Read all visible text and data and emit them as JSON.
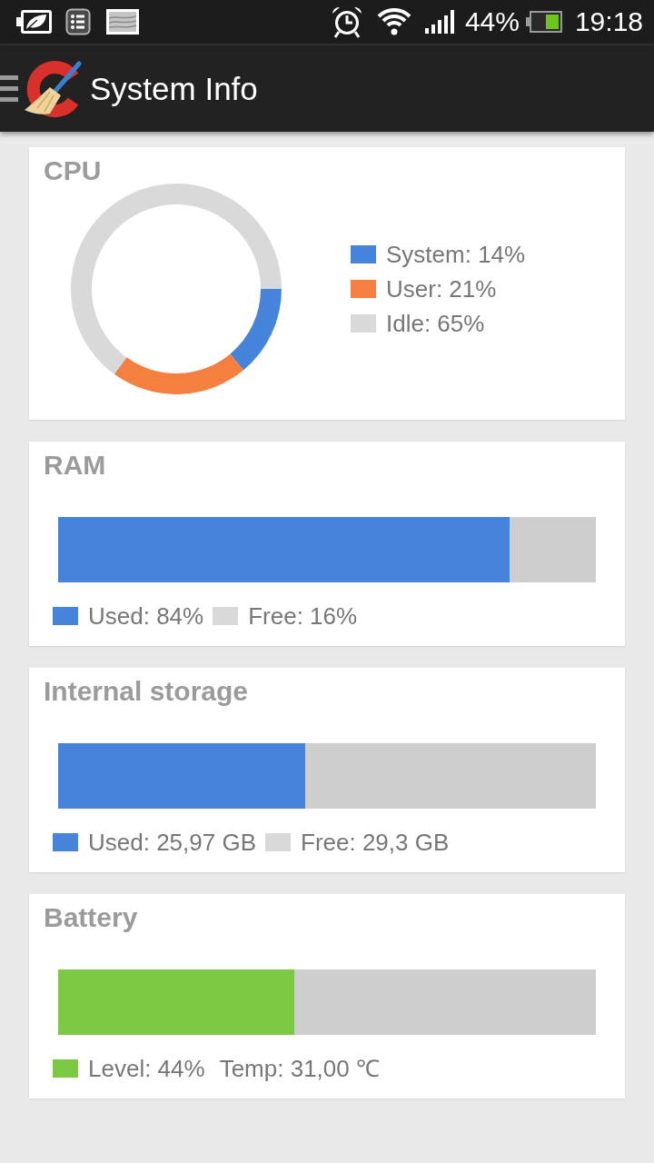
{
  "status_bar": {
    "battery": "44%",
    "time": "19:18"
  },
  "app_bar": {
    "title": "System Info"
  },
  "cards": [
    {
      "kind": "donut",
      "title": "CPU",
      "chart_data": {
        "type": "donut",
        "categories": [
          "System: 14%",
          "User: 21%",
          "Idle: 65%"
        ],
        "values": [
          14,
          21,
          65
        ],
        "colors": [
          "#4684db",
          "#f47f3e",
          "#d9d9d9"
        ],
        "legend": "right"
      }
    },
    {
      "kind": "bar",
      "title": "RAM",
      "level": 0.84,
      "legend": [
        {
          "label": "Used: 84%",
          "color": "#4684db"
        },
        {
          "label": "Free: 16%",
          "color": "#d9d9d9"
        }
      ]
    },
    {
      "kind": "bar",
      "title": "Internal storage",
      "level": 0.46,
      "legend": [
        {
          "label": "Used: 25,97 GB",
          "color": "#4684db"
        },
        {
          "label": "Free: 29,3 GB",
          "color": "#d9d9d9"
        }
      ]
    },
    {
      "kind": "bar",
      "title": "Battery",
      "level": 0.44,
      "legend": [
        {
          "label": "Level: 44%",
          "color": "#7cc943"
        },
        {
          "label": "Temp: 31,00 ℃"
        }
      ]
    }
  ]
}
